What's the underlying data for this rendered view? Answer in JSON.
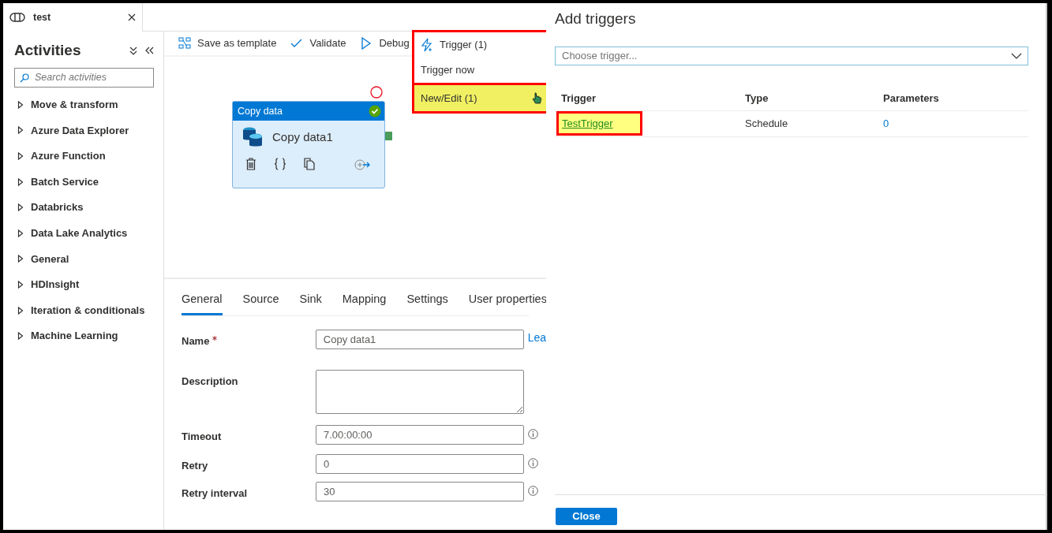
{
  "tab": {
    "title": "test"
  },
  "sidebar": {
    "title": "Activities",
    "search": {
      "placeholder": "Search activities"
    },
    "items": [
      {
        "label": "Move & transform",
        "expanded": false
      },
      {
        "label": "Azure Data Explorer",
        "expanded": false
      },
      {
        "label": "Azure Function",
        "expanded": false
      },
      {
        "label": "Batch Service",
        "expanded": false
      },
      {
        "label": "Databricks",
        "expanded": false
      },
      {
        "label": "Data Lake Analytics",
        "expanded": false
      },
      {
        "label": "General",
        "expanded": false
      },
      {
        "label": "HDInsight",
        "expanded": false
      },
      {
        "label": "Iteration & conditionals",
        "expanded": false
      },
      {
        "label": "Machine Learning",
        "expanded": false
      }
    ]
  },
  "toolbar": {
    "buttons": [
      {
        "label": "Save as template",
        "kind": "template"
      },
      {
        "label": "Validate",
        "kind": "validate"
      },
      {
        "label": "Debug",
        "kind": "debug"
      }
    ]
  },
  "trigger_menu": {
    "label": "Trigger (1)",
    "highlighted": true,
    "items": [
      {
        "label": "Trigger now",
        "selected": false
      },
      {
        "label": "New/Edit (1)",
        "selected": true
      }
    ]
  },
  "canvas": {
    "activity": {
      "type": "Copy data",
      "name": "Copy data1",
      "valid": true
    }
  },
  "properties": {
    "tabs": [
      {
        "label": "General",
        "selected": true
      },
      {
        "label": "Source",
        "selected": false
      },
      {
        "label": "Sink",
        "selected": false
      },
      {
        "label": "Mapping",
        "selected": false
      },
      {
        "label": "Settings",
        "selected": false
      },
      {
        "label": "User properties",
        "selected": false
      }
    ],
    "fields": [
      {
        "label": "Name",
        "kind": "input",
        "required": true,
        "value": "Copy data1",
        "link": "Lea"
      },
      {
        "label": "Description",
        "kind": "textarea"
      },
      {
        "label": "Timeout",
        "kind": "input",
        "value": "7.00:00:00",
        "info": true
      },
      {
        "label": "Retry",
        "kind": "input",
        "value": "0",
        "info": true
      },
      {
        "label": "Retry interval",
        "kind": "input",
        "value": "30",
        "info": true
      }
    ]
  },
  "add_triggers": {
    "title": "Add triggers",
    "select": {
      "placeholder": "Choose trigger..."
    },
    "columns": [
      "Trigger",
      "Type",
      "Parameters"
    ],
    "rows": [
      {
        "trigger": "TestTrigger",
        "type": "Schedule",
        "parameters": "0",
        "highlighted": true
      }
    ],
    "close_button": "Close"
  }
}
